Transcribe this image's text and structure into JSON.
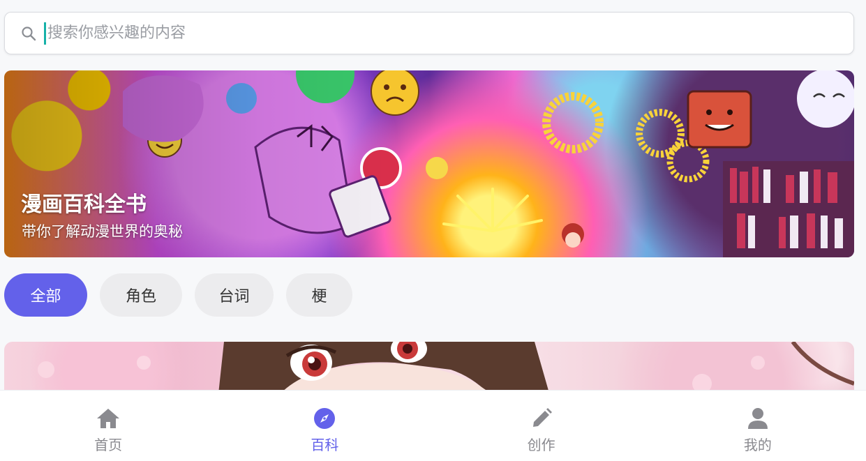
{
  "search": {
    "placeholder": "搜索你感兴趣的内容",
    "value": "",
    "icon": "search-icon"
  },
  "banner": {
    "title": "漫画百科全书",
    "subtitle": "带你了解动漫世界的奥秘"
  },
  "filters": [
    {
      "label": "全部",
      "active": true
    },
    {
      "label": "角色",
      "active": false
    },
    {
      "label": "台词",
      "active": false
    },
    {
      "label": "梗",
      "active": false
    }
  ],
  "nav": {
    "items": [
      {
        "label": "首页",
        "icon": "home-icon",
        "active": false
      },
      {
        "label": "百科",
        "icon": "compass-icon",
        "active": true
      },
      {
        "label": "创作",
        "icon": "pencil-icon",
        "active": false
      },
      {
        "label": "我的",
        "icon": "user-icon",
        "active": false
      }
    ]
  },
  "colors": {
    "accent": "#6361ea",
    "chip_inactive": "#ececee",
    "nav_inactive": "#8a8a8f",
    "caret": "#16b1a8"
  }
}
